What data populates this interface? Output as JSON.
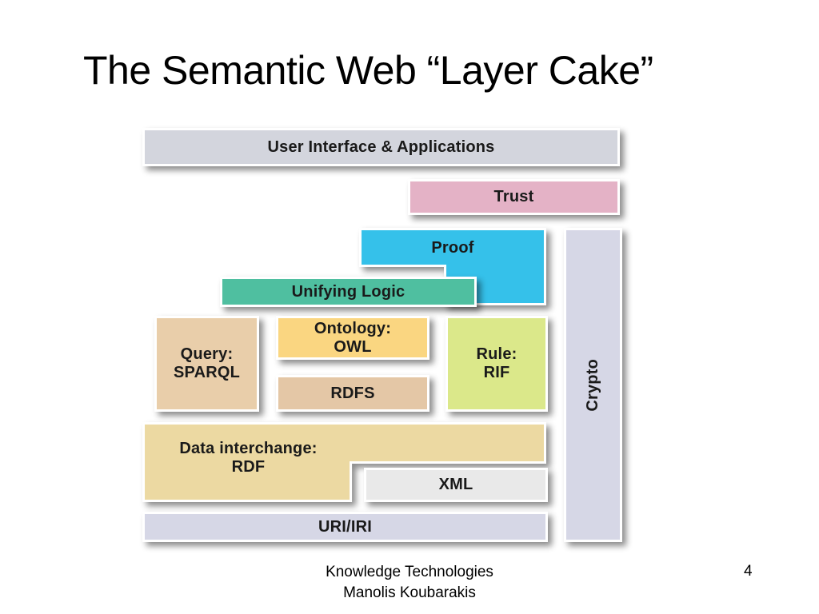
{
  "slide": {
    "title": "The Semantic Web “Layer Cake”",
    "number": "4",
    "footer_line1": "Knowledge Technologies",
    "footer_line2": "Manolis Koubarakis"
  },
  "diagram": {
    "name": "Semantic Web Layer Cake",
    "blocks": {
      "user_interface": {
        "label": "User Interface & Applications",
        "color": "#d3d5dd"
      },
      "trust": {
        "label": "Trust",
        "color": "#e4b2c6"
      },
      "proof": {
        "label": "Proof",
        "color": "#35c1ea"
      },
      "unifying_logic": {
        "label": "Unifying Logic",
        "color": "#4fbfa0"
      },
      "query": {
        "label_line1": "Query:",
        "label_line2": "SPARQL",
        "color": "#e9ceaa"
      },
      "ontology": {
        "label_line1": "Ontology:",
        "label_line2": "OWL",
        "color": "#fad681"
      },
      "rdfs": {
        "label": "RDFS",
        "color": "#e4c7a6"
      },
      "rule": {
        "label_line1": "Rule:",
        "label_line2": "RIF",
        "color": "#dbe88a"
      },
      "data_interchange": {
        "label_line1": "Data interchange:",
        "label_line2": "RDF",
        "color": "#ecd9a2"
      },
      "xml": {
        "label": "XML",
        "color": "#e9e9e9"
      },
      "uri": {
        "label": "URI/IRI",
        "color": "#d6d7e6"
      },
      "crypto": {
        "label": "Crypto",
        "color": "#d6d7e6"
      }
    }
  }
}
